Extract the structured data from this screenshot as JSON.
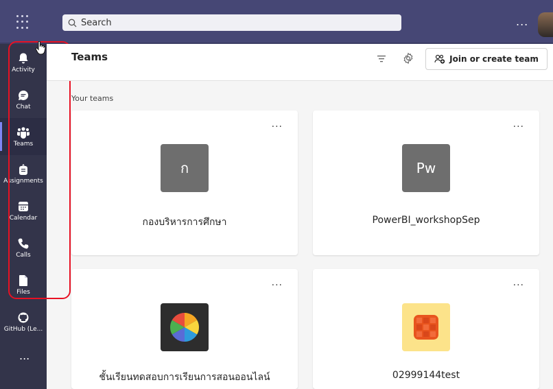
{
  "search": {
    "placeholder": "Search"
  },
  "topbar": {
    "more_label": "..."
  },
  "rail": {
    "items": [
      {
        "label": "Activity"
      },
      {
        "label": "Chat"
      },
      {
        "label": "Teams"
      },
      {
        "label": "Assignments"
      },
      {
        "label": "Calendar"
      },
      {
        "label": "Calls"
      },
      {
        "label": "Files"
      },
      {
        "label": "GitHub (Le..."
      }
    ],
    "more_label": "..."
  },
  "header": {
    "title": "Teams",
    "join_label": "Join or create team"
  },
  "section": {
    "label": "Your teams"
  },
  "teams": [
    {
      "initials": "ก",
      "name": "กองบริหารการศึกษา",
      "tile_color": "#6e6e6e",
      "more": "..."
    },
    {
      "initials": "Pw",
      "name": "PowerBI_workshopSep",
      "tile_color": "#6e6e6e",
      "more": "..."
    },
    {
      "initials": "",
      "name": "ชั้นเรียนทดสอบการเรียนการสอนออนไลน์",
      "tile_color": "#2d2d2d",
      "more": "..."
    },
    {
      "initials": "",
      "name": "02999144test",
      "tile_color": "#fce38a",
      "more": "..."
    }
  ],
  "colors": {
    "titlebar": "#464775",
    "rail": "#33344a",
    "accent": "#7f85f5",
    "highlight": "#e81123"
  }
}
